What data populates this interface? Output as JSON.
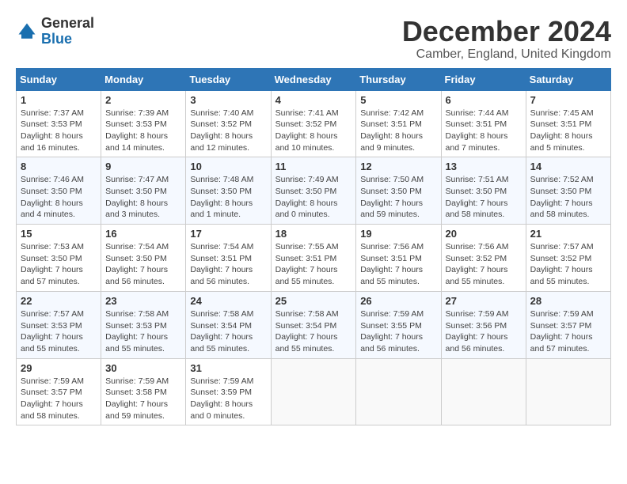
{
  "header": {
    "logo_line1": "General",
    "logo_line2": "Blue",
    "month_title": "December 2024",
    "location": "Camber, England, United Kingdom"
  },
  "weekdays": [
    "Sunday",
    "Monday",
    "Tuesday",
    "Wednesday",
    "Thursday",
    "Friday",
    "Saturday"
  ],
  "weeks": [
    [
      {
        "day": "1",
        "sunrise": "7:37 AM",
        "sunset": "3:53 PM",
        "daylight": "8 hours and 16 minutes."
      },
      {
        "day": "2",
        "sunrise": "7:39 AM",
        "sunset": "3:53 PM",
        "daylight": "8 hours and 14 minutes."
      },
      {
        "day": "3",
        "sunrise": "7:40 AM",
        "sunset": "3:52 PM",
        "daylight": "8 hours and 12 minutes."
      },
      {
        "day": "4",
        "sunrise": "7:41 AM",
        "sunset": "3:52 PM",
        "daylight": "8 hours and 10 minutes."
      },
      {
        "day": "5",
        "sunrise": "7:42 AM",
        "sunset": "3:51 PM",
        "daylight": "8 hours and 9 minutes."
      },
      {
        "day": "6",
        "sunrise": "7:44 AM",
        "sunset": "3:51 PM",
        "daylight": "8 hours and 7 minutes."
      },
      {
        "day": "7",
        "sunrise": "7:45 AM",
        "sunset": "3:51 PM",
        "daylight": "8 hours and 5 minutes."
      }
    ],
    [
      {
        "day": "8",
        "sunrise": "7:46 AM",
        "sunset": "3:50 PM",
        "daylight": "8 hours and 4 minutes."
      },
      {
        "day": "9",
        "sunrise": "7:47 AM",
        "sunset": "3:50 PM",
        "daylight": "8 hours and 3 minutes."
      },
      {
        "day": "10",
        "sunrise": "7:48 AM",
        "sunset": "3:50 PM",
        "daylight": "8 hours and 1 minute."
      },
      {
        "day": "11",
        "sunrise": "7:49 AM",
        "sunset": "3:50 PM",
        "daylight": "8 hours and 0 minutes."
      },
      {
        "day": "12",
        "sunrise": "7:50 AM",
        "sunset": "3:50 PM",
        "daylight": "7 hours and 59 minutes."
      },
      {
        "day": "13",
        "sunrise": "7:51 AM",
        "sunset": "3:50 PM",
        "daylight": "7 hours and 58 minutes."
      },
      {
        "day": "14",
        "sunrise": "7:52 AM",
        "sunset": "3:50 PM",
        "daylight": "7 hours and 58 minutes."
      }
    ],
    [
      {
        "day": "15",
        "sunrise": "7:53 AM",
        "sunset": "3:50 PM",
        "daylight": "7 hours and 57 minutes."
      },
      {
        "day": "16",
        "sunrise": "7:54 AM",
        "sunset": "3:50 PM",
        "daylight": "7 hours and 56 minutes."
      },
      {
        "day": "17",
        "sunrise": "7:54 AM",
        "sunset": "3:51 PM",
        "daylight": "7 hours and 56 minutes."
      },
      {
        "day": "18",
        "sunrise": "7:55 AM",
        "sunset": "3:51 PM",
        "daylight": "7 hours and 55 minutes."
      },
      {
        "day": "19",
        "sunrise": "7:56 AM",
        "sunset": "3:51 PM",
        "daylight": "7 hours and 55 minutes."
      },
      {
        "day": "20",
        "sunrise": "7:56 AM",
        "sunset": "3:52 PM",
        "daylight": "7 hours and 55 minutes."
      },
      {
        "day": "21",
        "sunrise": "7:57 AM",
        "sunset": "3:52 PM",
        "daylight": "7 hours and 55 minutes."
      }
    ],
    [
      {
        "day": "22",
        "sunrise": "7:57 AM",
        "sunset": "3:53 PM",
        "daylight": "7 hours and 55 minutes."
      },
      {
        "day": "23",
        "sunrise": "7:58 AM",
        "sunset": "3:53 PM",
        "daylight": "7 hours and 55 minutes."
      },
      {
        "day": "24",
        "sunrise": "7:58 AM",
        "sunset": "3:54 PM",
        "daylight": "7 hours and 55 minutes."
      },
      {
        "day": "25",
        "sunrise": "7:58 AM",
        "sunset": "3:54 PM",
        "daylight": "7 hours and 55 minutes."
      },
      {
        "day": "26",
        "sunrise": "7:59 AM",
        "sunset": "3:55 PM",
        "daylight": "7 hours and 56 minutes."
      },
      {
        "day": "27",
        "sunrise": "7:59 AM",
        "sunset": "3:56 PM",
        "daylight": "7 hours and 56 minutes."
      },
      {
        "day": "28",
        "sunrise": "7:59 AM",
        "sunset": "3:57 PM",
        "daylight": "7 hours and 57 minutes."
      }
    ],
    [
      {
        "day": "29",
        "sunrise": "7:59 AM",
        "sunset": "3:57 PM",
        "daylight": "7 hours and 58 minutes."
      },
      {
        "day": "30",
        "sunrise": "7:59 AM",
        "sunset": "3:58 PM",
        "daylight": "7 hours and 59 minutes."
      },
      {
        "day": "31",
        "sunrise": "7:59 AM",
        "sunset": "3:59 PM",
        "daylight": "8 hours and 0 minutes."
      },
      null,
      null,
      null,
      null
    ]
  ]
}
